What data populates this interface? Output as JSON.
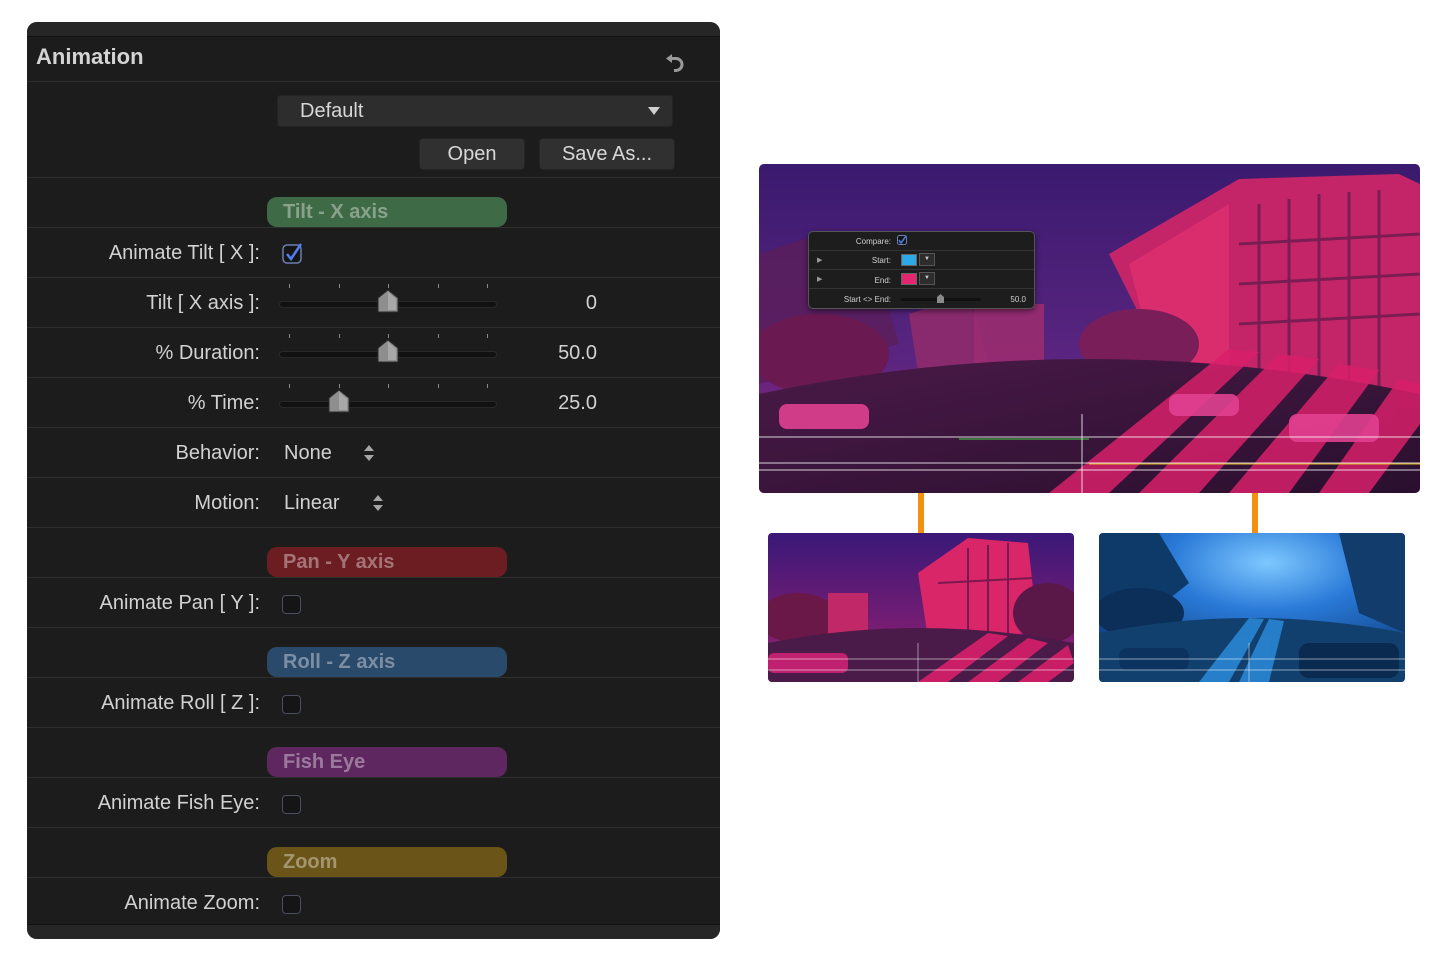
{
  "panel": {
    "title": "Animation",
    "preset_value": "Default",
    "open_label": "Open",
    "save_as_label": "Save As...",
    "sections": {
      "tilt": {
        "label": "Tilt - X axis",
        "color": "#3f6a46"
      },
      "pan": {
        "label": "Pan - Y axis",
        "color": "#6b1d22"
      },
      "roll": {
        "label": "Roll - Z axis",
        "color": "#2a4a6c"
      },
      "fish": {
        "label": "Fish Eye",
        "color": "#5e275f"
      },
      "zoom": {
        "label": "Zoom",
        "color": "#6a5418"
      }
    },
    "animate_tilt": {
      "label": "Animate Tilt [ X ]:",
      "checked": true
    },
    "tilt_x": {
      "label": "Tilt [ X axis ]:",
      "value": "0",
      "fraction": 0.5
    },
    "duration": {
      "label": "% Duration:",
      "value": "50.0",
      "fraction": 0.5
    },
    "time": {
      "label": "% Time:",
      "value": "25.0",
      "fraction": 0.25
    },
    "behavior": {
      "label": "Behavior:",
      "value": "None"
    },
    "motion": {
      "label": "Motion:",
      "value": "Linear"
    },
    "animate_pan": {
      "label": "Animate Pan [ Y ]:",
      "checked": false
    },
    "animate_roll": {
      "label": "Animate Roll [ Z ]:",
      "checked": false
    },
    "animate_fish": {
      "label": "Animate Fish Eye:",
      "checked": false
    },
    "animate_zoom": {
      "label": "Animate Zoom:",
      "checked": false
    }
  },
  "compare_popup": {
    "compare_label": "Compare:",
    "compare_checked": true,
    "start_label": "Start:",
    "start_color": "#2fa8e6",
    "end_label": "End:",
    "end_color": "#e2276f",
    "start_end_label": "Start <> End:",
    "start_end_value": "50.0"
  },
  "colors": {
    "panel_bg": "#1c1c1c",
    "connector": "#f29010",
    "start_tint": "#d8206a",
    "end_tint": "#1e78c8"
  },
  "icons": {
    "reset": "reset-arrow-icon",
    "dropdown": "triangle-down-icon",
    "stepper": "up-down-arrows-icon",
    "check": "checkmark-icon"
  }
}
